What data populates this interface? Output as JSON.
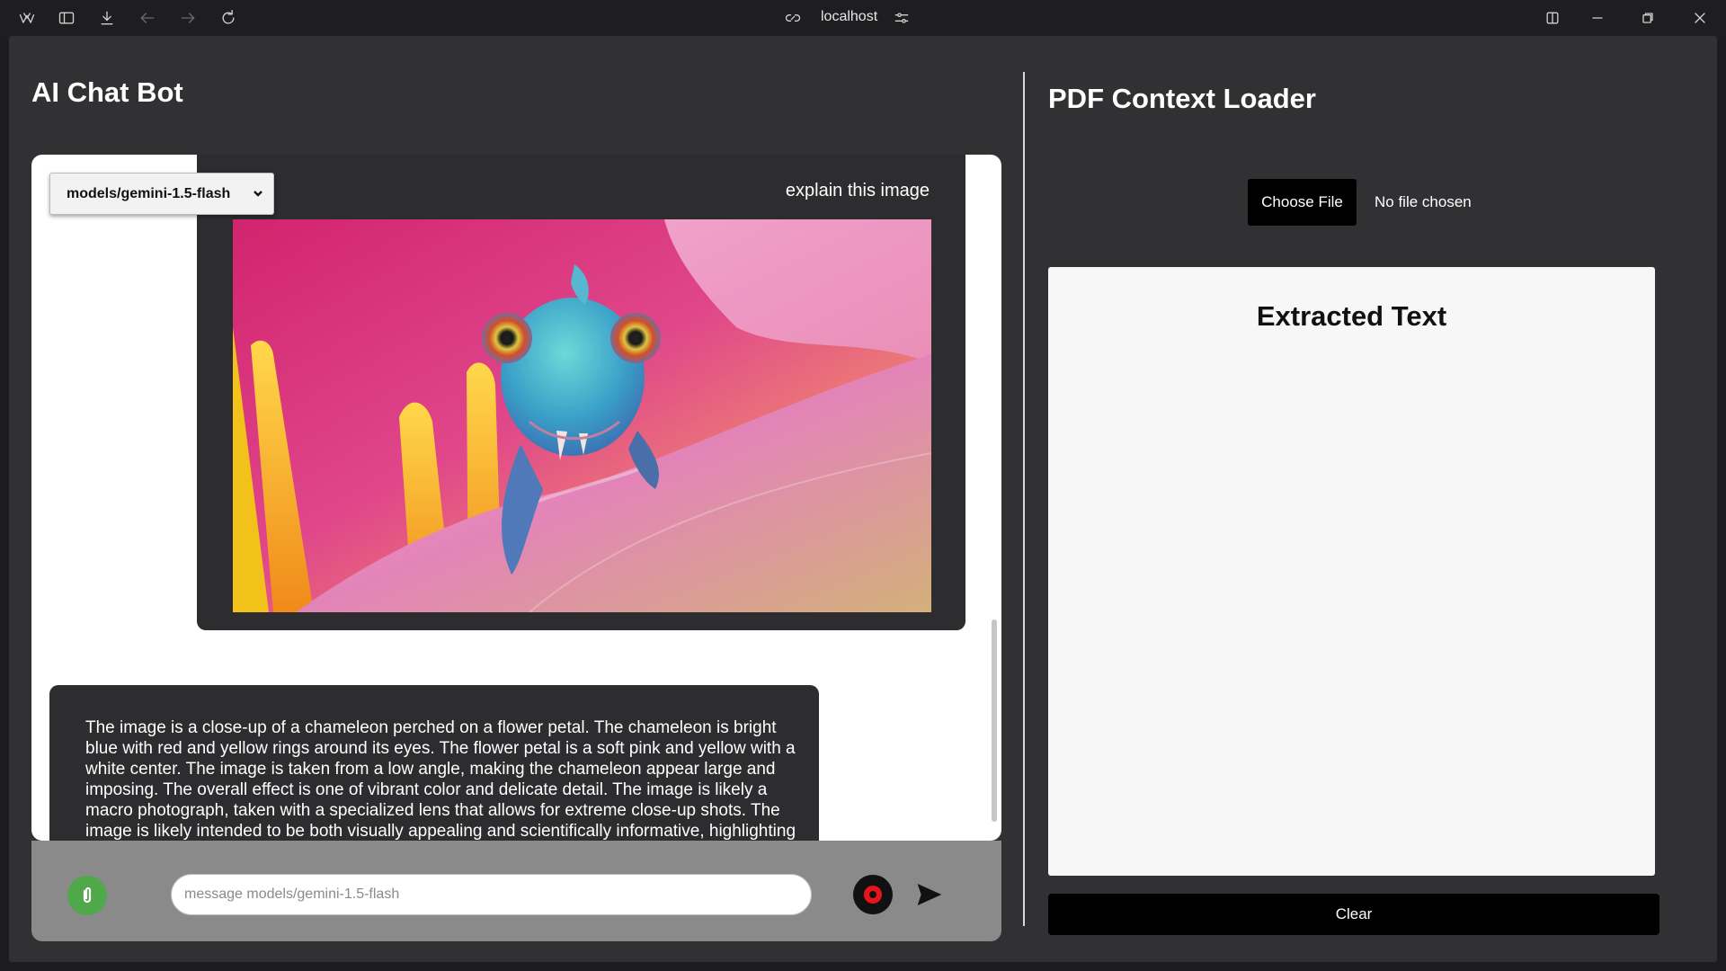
{
  "browser": {
    "url": "localhost",
    "icons": [
      "app-logo-icon",
      "sidebar-toggle-icon",
      "download-icon",
      "back-arrow-icon",
      "forward-arrow-icon",
      "reload-icon",
      "link-icon",
      "tune-icon",
      "split-view-icon",
      "minimize-icon",
      "restore-icon",
      "close-icon"
    ]
  },
  "chat": {
    "title": "AI Chat Bot",
    "model_selected": "models/gemini-1.5-flash",
    "messages": [
      {
        "role": "user",
        "text": "explain this image",
        "attachment": "chameleon-on-flower-photo"
      },
      {
        "role": "bot",
        "text": "The image is a close-up of a chameleon perched on a flower petal. The chameleon is bright blue with red and yellow rings around its eyes. The flower petal is a soft pink and yellow with a white center. The image is taken from a low angle, making the chameleon appear large and imposing. The overall effect is one of vibrant color and delicate detail. The image is likely a macro photograph, taken with a specialized lens that allows for extreme close-up shots. The image is likely intended to be both visually appealing and scientifically informative, highlighting the beauty and complexity of nature."
      }
    ],
    "input": {
      "value": "",
      "placeholder": "message models/gemini-1.5-flash"
    },
    "colors": {
      "attach": "#4fa84a",
      "record": "#e8141b",
      "bubble": "#2d2d2f"
    }
  },
  "pdf": {
    "title": "PDF Context Loader",
    "choose_file_label": "Choose File",
    "file_status": "No file chosen",
    "extracted_title": "Extracted Text",
    "clear_label": "Clear"
  }
}
